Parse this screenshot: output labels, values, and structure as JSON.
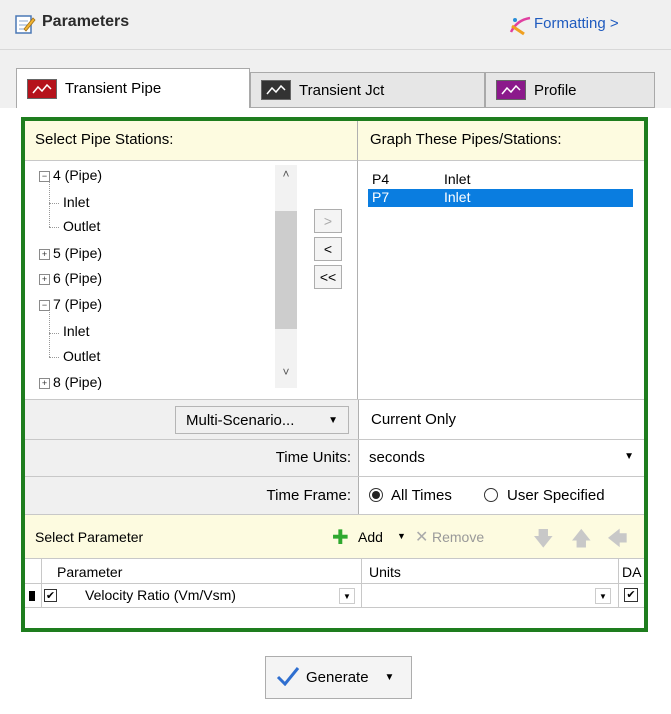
{
  "header": {
    "title": "Parameters",
    "formatting_link": "Formatting >"
  },
  "tabs": [
    {
      "label": "Transient Pipe",
      "active": true,
      "icon_color": "#b5121b"
    },
    {
      "label": "Transient Jct",
      "active": false,
      "icon_color": "#333333"
    },
    {
      "label": "Profile",
      "active": false,
      "icon_color": "#8b1a8b"
    }
  ],
  "stations": {
    "left_header": "Select Pipe Stations:",
    "right_header": "Graph These Pipes/Stations:",
    "tree": [
      {
        "label": "4 (Pipe)",
        "expanded": true
      },
      {
        "label": "Inlet"
      },
      {
        "label": "Outlet"
      },
      {
        "label": "5 (Pipe)",
        "expanded": false
      },
      {
        "label": "6 (Pipe)",
        "expanded": false
      },
      {
        "label": "7 (Pipe)",
        "expanded": true
      },
      {
        "label": "Inlet"
      },
      {
        "label": "Outlet"
      },
      {
        "label": "8 (Pipe)",
        "expanded": false
      }
    ],
    "buttons": {
      "add": ">",
      "remove": "<",
      "remove_all": "<<"
    },
    "selected": [
      {
        "pipe": "P4",
        "station": "Inlet",
        "highlighted": false
      },
      {
        "pipe": "P7",
        "station": "Inlet",
        "highlighted": true
      }
    ]
  },
  "scenario": {
    "button": "Multi-Scenario...",
    "value": "Current Only"
  },
  "time_units": {
    "label": "Time Units:",
    "value": "seconds"
  },
  "time_frame": {
    "label": "Time Frame:",
    "option_all": "All Times",
    "option_user": "User Specified",
    "selected": "all"
  },
  "parameters": {
    "header": "Select Parameter",
    "add_label": "Add",
    "remove_label": "Remove",
    "columns": {
      "parameter": "Parameter",
      "units": "Units",
      "da": "DA"
    },
    "rows": [
      {
        "checked": true,
        "parameter": "Velocity Ratio (Vm/Vsm)",
        "units": "",
        "da": true
      }
    ]
  },
  "generate_label": "Generate"
}
